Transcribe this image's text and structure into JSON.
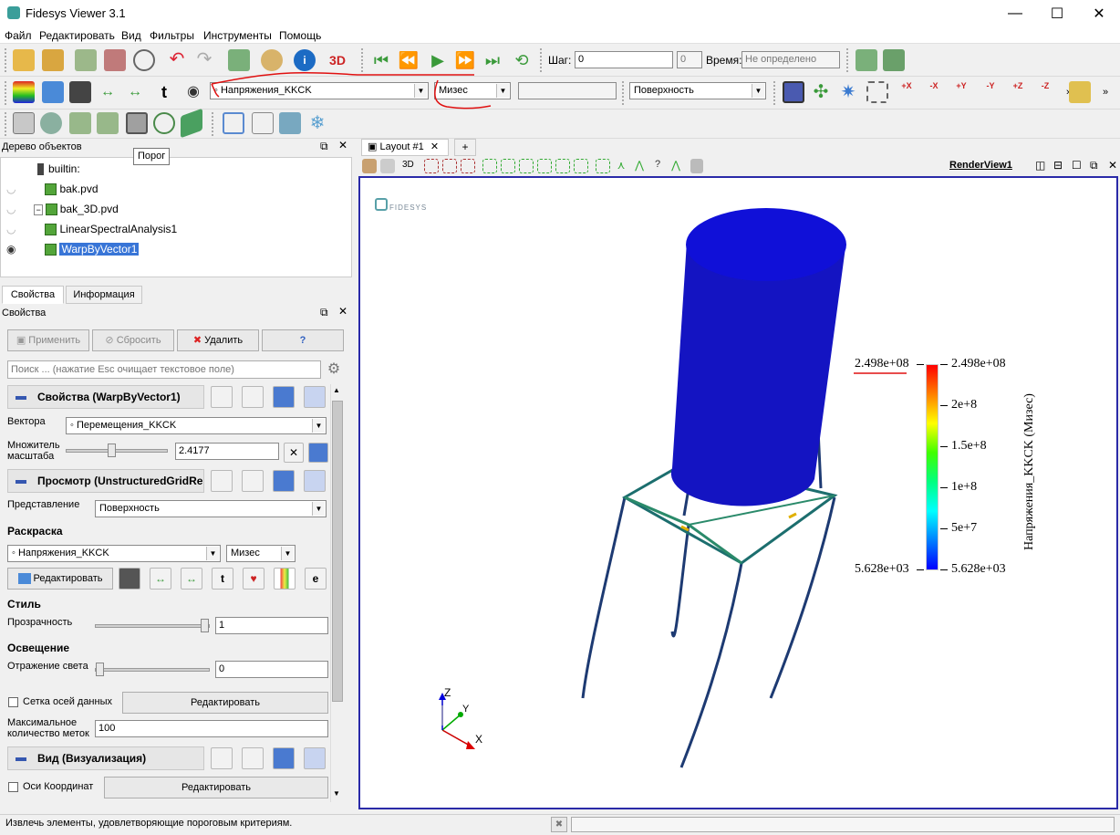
{
  "window": {
    "title": "Fidesys Viewer 3.1",
    "controls": {
      "minimize": "—",
      "maximize": "☐",
      "close": "✕"
    }
  },
  "menu": [
    "Файл",
    "Редактировать",
    "Вид",
    "Фильтры",
    "Инструменты",
    "Помощь"
  ],
  "toolbar_time": {
    "step_label": "Шаг:",
    "step_value": "0",
    "step_max": "0",
    "time_label": "Время:",
    "time_value": "Не определено",
    "icon_3d": "3D"
  },
  "toolbar_color": {
    "array": "Напряжения_KKCK",
    "component": "Мизес",
    "representation": "Поверхность",
    "axis_buttons": [
      "+X",
      "-X",
      "+Y",
      "-Y",
      "+Z",
      "-Z"
    ]
  },
  "tooltip": "Порог",
  "pipeline": {
    "title": "Дерево объектов",
    "items": [
      {
        "label": "builtin:",
        "eye": false
      },
      {
        "label": "bak.pvd",
        "eye": true
      },
      {
        "label": "bak_3D.pvd",
        "eye": true
      },
      {
        "label": "LinearSpectralAnalysis1",
        "eye": true
      },
      {
        "label": "WarpByVector1",
        "eye": true,
        "selected": true
      }
    ]
  },
  "tabs": [
    "Свойства",
    "Информация"
  ],
  "properties": {
    "title": "Свойства",
    "apply": "Применить",
    "reset": "Сбросить",
    "delete": "Удалить",
    "help": "?",
    "search_placeholder": "Поиск ... (нажатие Esc очищает текстовое поле)",
    "section_props": "Свойства (WarpByVector1)",
    "vectors_label": "Вектора",
    "vectors_value": "Перемещения_KKCK",
    "scale_label_1": "Множитель",
    "scale_label_2": "масштаба",
    "scale_value": "2.4177",
    "scale_slider": 0.45,
    "section_display": "Просмотр (UnstructuredGridRe",
    "repr_label": "Представление",
    "repr_value": "Поверхность",
    "coloring": "Раскраска",
    "color_array": "Напряжения_KKCK",
    "color_comp": "Мизес",
    "edit": "Редактировать",
    "style": "Стиль",
    "opacity_label": "Прозрачность",
    "opacity_value": "1",
    "opacity_slider": 1.0,
    "lighting": "Освещение",
    "specular_label": "Отражение света",
    "specular_value": "0",
    "specular_slider": 0.0,
    "grid_axes": "Сетка осей данных",
    "edit2": "Редактировать",
    "max_labels_1": "Максимальное",
    "max_labels_2": "количество меток",
    "max_labels_value": "100",
    "section_view": "Вид (Визуализация)",
    "orient_axes": "Оси Координат",
    "edit3": "Редактировать"
  },
  "layout": {
    "tab": "Layout #1",
    "close": "✕",
    "add": "+",
    "view_name": "RenderView1",
    "btn_3d": "3D"
  },
  "viewport": {
    "logo": "FIDESYS",
    "colorbar": {
      "title": "Напряжения_KKCK (Мизес)",
      "max_left": "2.498e+08",
      "min_left": "5.628e+03",
      "ticks": [
        "2.498e+08",
        "2e+8",
        "1.5e+8",
        "1e+8",
        "5e+7",
        "5.628e+03"
      ]
    },
    "axes": {
      "x": "X",
      "y": "Y",
      "z": "Z"
    }
  },
  "status": "Извлечь элементы, удовлетворяющие пороговым критериям.",
  "colors": {
    "selection": "#3875d7",
    "viewport_border": "#2a2aa8",
    "cylinder": "#1010c8"
  }
}
